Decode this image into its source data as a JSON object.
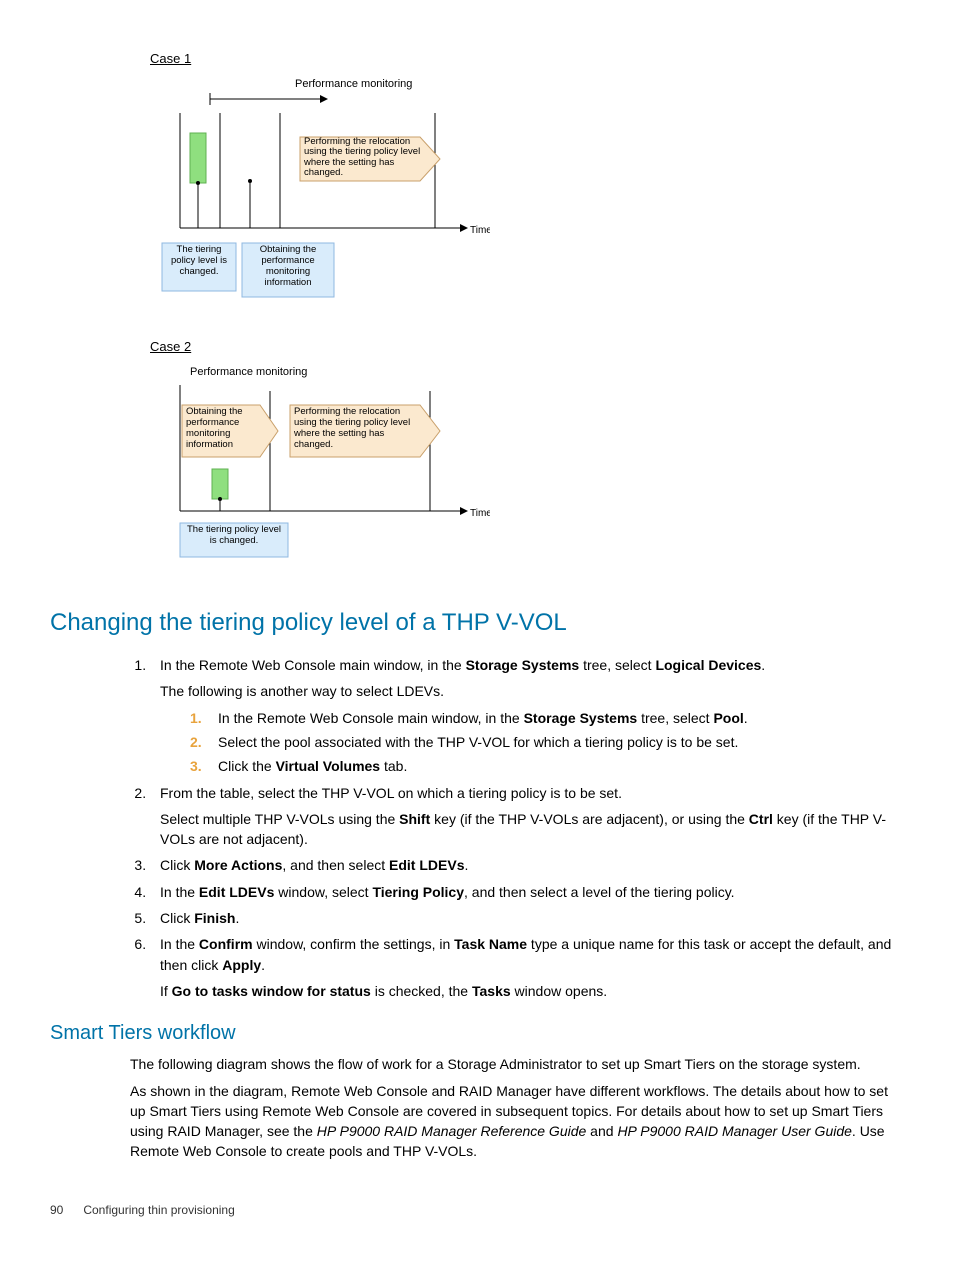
{
  "diagram": {
    "case1_label": "Case 1",
    "case1_top": "Performance monitoring",
    "case1_time": "Time",
    "case1_box_left": "The tiering policy level is changed.",
    "case1_box_mid": "Obtaining the performance monitoring information",
    "case1_arrow_box": "Performing the relocation using the tiering policy level where the setting has changed.",
    "case2_label": "Case 2",
    "case2_top": "Performance monitoring",
    "case2_time": "Time",
    "case2_box_left": "Obtaining the performance monitoring information",
    "case2_arrow_box": "Performing the relocation using the tiering policy level where the setting has changed.",
    "case2_box_bottom": "The tiering policy level is changed."
  },
  "h2_1": "Changing the tiering policy level of a THP V-VOL",
  "step1_a": "In the Remote Web Console main window, in the ",
  "step1_b": "Storage Systems",
  "step1_c": " tree, select ",
  "step1_d": "Logical Devices",
  "step1_e": ".",
  "step1_para": "The following is another way to select LDEVs.",
  "sub1_a": "In the Remote Web Console main window, in the ",
  "sub1_b": "Storage Systems",
  "sub1_c": " tree, select ",
  "sub1_d": "Pool",
  "sub1_e": ".",
  "sub2": "Select the pool associated with the THP V-VOL for which a tiering policy is to be set.",
  "sub3_a": "Click the ",
  "sub3_b": "Virtual Volumes",
  "sub3_c": " tab.",
  "step2_a": "From the table, select the THP V-VOL on which a tiering policy is to be set.",
  "step2_p_a": "Select multiple THP V-VOLs using the ",
  "step2_p_b": "Shift",
  "step2_p_c": " key (if the THP V-VOLs are adjacent), or using the ",
  "step2_p_d": "Ctrl",
  "step2_p_e": " key (if the THP V-VOLs are not adjacent).",
  "step3_a": "Click ",
  "step3_b": "More Actions",
  "step3_c": ", and then select ",
  "step3_d": "Edit LDEVs",
  "step3_e": ".",
  "step4_a": "In the ",
  "step4_b": "Edit LDEVs",
  "step4_c": " window, select ",
  "step4_d": "Tiering Policy",
  "step4_e": ", and then select a level of the tiering policy.",
  "step5_a": "Click ",
  "step5_b": "Finish",
  "step5_c": ".",
  "step6_a": "In the ",
  "step6_b": "Confirm",
  "step6_c": " window, confirm the settings, in ",
  "step6_d": "Task Name",
  "step6_e": " type a unique name for this task or accept the default, and then click ",
  "step6_f": "Apply",
  "step6_g": ".",
  "step6_p_a": "If ",
  "step6_p_b": "Go to tasks window for status",
  "step6_p_c": " is checked, the ",
  "step6_p_d": "Tasks",
  "step6_p_e": " window opens.",
  "h3_1": "Smart Tiers workflow",
  "workflow_p1": "The following diagram shows the flow of work for a Storage Administrator to set up Smart Tiers on the storage system.",
  "workflow_p2_a": "As shown in the diagram, Remote Web Console and RAID Manager have different workflows. The details about how to set up Smart Tiers using Remote Web Console are covered in subsequent topics. For details about how to set up Smart Tiers using RAID Manager, see the ",
  "workflow_p2_b": "HP P9000 RAID Manager Reference Guide",
  "workflow_p2_c": " and ",
  "workflow_p2_d": "HP P9000 RAID Manager User Guide",
  "workflow_p2_e": ". Use Remote Web Console to create pools and THP V-VOLs.",
  "footer_page": "90",
  "footer_text": "Configuring thin provisioning"
}
